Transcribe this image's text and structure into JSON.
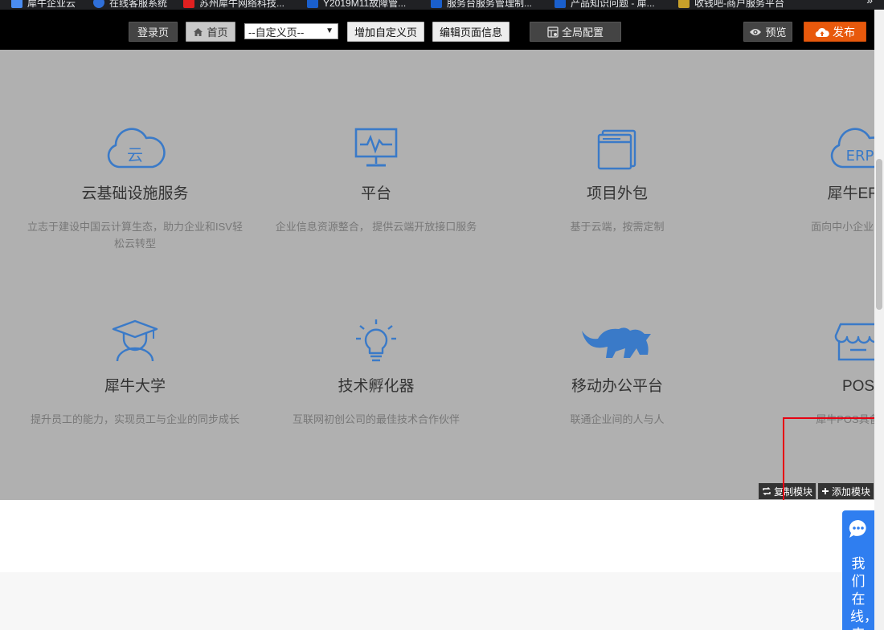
{
  "bookmarks": [
    {
      "label": "犀牛企业云",
      "color": "#4a8cf0"
    },
    {
      "label": "在线客服系统",
      "color": "#2f6fd8"
    },
    {
      "label": "苏州犀牛网络科技...",
      "color": "#e02020"
    },
    {
      "label": "Y2019M11故障管...",
      "color": "#1a5fcc"
    },
    {
      "label": "服务台服务管理制...",
      "color": "#1a5fcc"
    },
    {
      "label": "产品知识问题 - 犀...",
      "color": "#1a5fcc"
    },
    {
      "label": "收钱吧-商户服务平台",
      "color": "#c8a02a"
    }
  ],
  "bookmarks_more": "»",
  "toolbar": {
    "login_page": "登录页",
    "home": "首页",
    "custom_page_select": "--自定义页--",
    "add_custom_page": "增加自定义页",
    "edit_page_info": "编辑页面信息",
    "global_config": "全局配置",
    "preview": "预览",
    "publish": "发布"
  },
  "services": [
    {
      "icon": "cloud-icon",
      "icon_text": "云",
      "title": "云基础设施服务",
      "desc": "立志于建设中国云计算生态，助力企业和ISV轻松云转型"
    },
    {
      "icon": "monitor-icon",
      "title": "平台",
      "desc": "企业信息资源整合， 提供云端开放接口服务"
    },
    {
      "icon": "window-icon",
      "title": "项目外包",
      "desc": "基于云端，按需定制"
    },
    {
      "icon": "erp-cloud-icon",
      "icon_text": "ERP",
      "title": "犀牛ERP",
      "desc": "面向中小企业的ERP"
    },
    {
      "icon": "graduate-icon",
      "title": "犀牛大学",
      "desc": "提升员工的能力，实现员工与企业的同步成长"
    },
    {
      "icon": "lightbulb-icon",
      "title": "技术孵化器",
      "desc": "互联网初创公司的最佳技术合作伙伴"
    },
    {
      "icon": "rhino-icon",
      "title": "移动办公平台",
      "desc": "联通企业间的人与人"
    },
    {
      "icon": "store-icon",
      "title": "POS",
      "desc": "犀牛POS具备您最"
    }
  ],
  "module_actions": {
    "copy": "复制模块",
    "add": "添加模块"
  },
  "chat": {
    "text": "我们在线，来"
  },
  "colors": {
    "accent_blue": "#3a7ac8",
    "publish_orange": "#e8590c",
    "highlight_red": "#e60012",
    "chat_blue": "#2f7ef0"
  }
}
